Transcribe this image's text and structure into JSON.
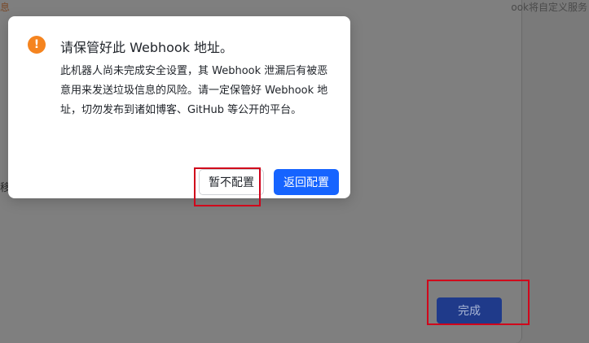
{
  "background": {
    "left_top_text": "息",
    "left_mid_text": "移",
    "right_top_text": "ook将自定义服务",
    "finish_label": "完成"
  },
  "dialog": {
    "icon": "exclamation-icon",
    "icon_glyph": "!",
    "title": "请保管好此 Webhook 地址。",
    "body": "此机器人尚未完成安全设置，其 Webhook 泄漏后有被恶意用来发送垃圾信息的风险。请一定保管好 Webhook 地址，切勿发布到诸如博客、GitHub 等公开的平台。",
    "skip_label": "暂不配置",
    "back_label": "返回配置"
  },
  "colors": {
    "accent": "#1664ff",
    "warning": "#f5841f",
    "highlight": "#d0021b"
  }
}
